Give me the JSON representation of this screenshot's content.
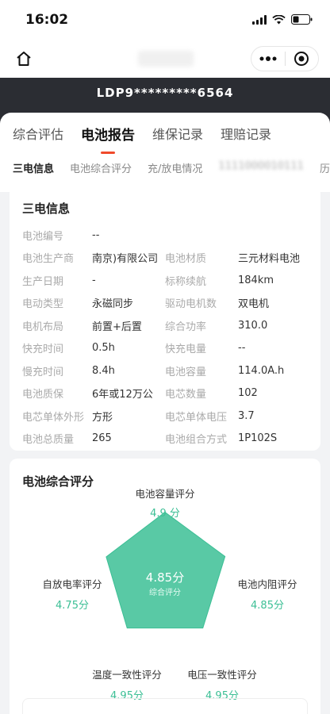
{
  "status_bar": {
    "time": "16:02"
  },
  "header": {
    "vin": "LDP9*********6564"
  },
  "main_tabs": [
    {
      "label": "综合评估"
    },
    {
      "label": "电池报告"
    },
    {
      "label": "维保记录"
    },
    {
      "label": "理赔记录"
    }
  ],
  "sub_tabs": [
    {
      "label": "三电信息"
    },
    {
      "label": "电池综合评分"
    },
    {
      "label": "充/放电情况"
    },
    {
      "label": "1111000010111"
    },
    {
      "label": "历"
    }
  ],
  "battery_info": {
    "title": "三电信息",
    "rows": [
      {
        "label1": "电池编号",
        "value1": "--",
        "label2": "",
        "value2": ""
      },
      {
        "label1": "电池生产商",
        "value1": "南京)有限公司",
        "label2": "电池材质",
        "value2": "三元材料电池"
      },
      {
        "label1": "生产日期",
        "value1": "-",
        "label2": "标称续航",
        "value2": "184km"
      },
      {
        "label1": "电动类型",
        "value1": "永磁同步",
        "label2": "驱动电机数",
        "value2": "双电机"
      },
      {
        "label1": "电机布局",
        "value1": "前置+后置",
        "label2": "综合功率",
        "value2": "310.0"
      },
      {
        "label1": "快充时间",
        "value1": "0.5h",
        "label2": "快充电量",
        "value2": "--"
      },
      {
        "label1": "慢充时间",
        "value1": "8.4h",
        "label2": "电池容量",
        "value2": "114.0A.h"
      },
      {
        "label1": "电池质保",
        "value1": "6年或12万公",
        "label2": "电芯数量",
        "value2": "102"
      },
      {
        "label1": "电芯单体外形",
        "value1": "方形",
        "label2": "电芯单体电压",
        "value2": "3.7"
      },
      {
        "label1": "电池总质量",
        "value1": "265",
        "label2": "电池组合方式",
        "value2": "1P102S"
      }
    ]
  },
  "score": {
    "title": "电池综合评分",
    "center_value": "4.85分",
    "center_label": "综合评分",
    "max": 5,
    "accent": "#3cbf95",
    "axes": [
      {
        "label": "电池容量评分",
        "score_text": "4.9 分",
        "value": 4.9
      },
      {
        "label": "电池内阻评分",
        "score_text": "4.85分",
        "value": 4.85
      },
      {
        "label": "电压一致性评分",
        "score_text": "4.95分",
        "value": 4.95
      },
      {
        "label": "温度一致性评分",
        "score_text": "4.95分",
        "value": 4.95
      },
      {
        "label": "自放电率评分",
        "score_text": "4.75分",
        "value": 4.75
      }
    ]
  }
}
